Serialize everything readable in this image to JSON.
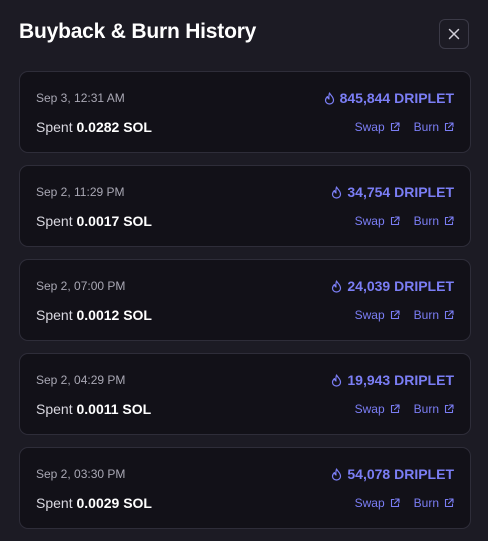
{
  "header": {
    "title": "Buyback & Burn History",
    "close_icon": "close-icon"
  },
  "colors": {
    "accent": "#7b7ef5",
    "background": "#1c1b24",
    "card": "#121118"
  },
  "entries": [
    {
      "date": "Sep 3, 12:31 AM",
      "amount": "845,844 DRIPLET",
      "spent_label": "Spent",
      "spent_value": "0.0282 SOL",
      "swap_label": "Swap",
      "burn_label": "Burn"
    },
    {
      "date": "Sep 2, 11:29 PM",
      "amount": "34,754 DRIPLET",
      "spent_label": "Spent",
      "spent_value": "0.0017 SOL",
      "swap_label": "Swap",
      "burn_label": "Burn"
    },
    {
      "date": "Sep 2, 07:00 PM",
      "amount": "24,039 DRIPLET",
      "spent_label": "Spent",
      "spent_value": "0.0012 SOL",
      "swap_label": "Swap",
      "burn_label": "Burn"
    },
    {
      "date": "Sep 2, 04:29 PM",
      "amount": "19,943 DRIPLET",
      "spent_label": "Spent",
      "spent_value": "0.0011 SOL",
      "swap_label": "Swap",
      "burn_label": "Burn"
    },
    {
      "date": "Sep 2, 03:30 PM",
      "amount": "54,078 DRIPLET",
      "spent_label": "Spent",
      "spent_value": "0.0029 SOL",
      "swap_label": "Swap",
      "burn_label": "Burn"
    }
  ]
}
